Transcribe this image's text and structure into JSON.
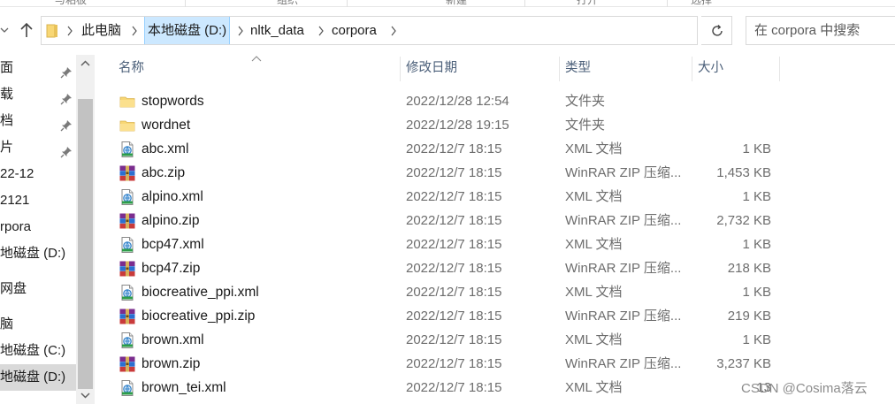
{
  "ribbon": {
    "tabs": [
      "与粘板",
      "组织",
      "新建",
      "打开",
      "选择"
    ]
  },
  "address_bar": {
    "crumbs": [
      "此电脑",
      "本地磁盘 (D:)",
      "nltk_data",
      "corpora"
    ]
  },
  "search": {
    "placeholder": "在 corpora 中搜索"
  },
  "nav_pane": {
    "items": [
      {
        "label": "面",
        "pinned": true
      },
      {
        "label": "载",
        "pinned": true
      },
      {
        "label": "档",
        "pinned": true
      },
      {
        "label": "片",
        "pinned": true
      },
      {
        "label": "22-12",
        "pinned": false
      },
      {
        "label": "2121",
        "pinned": false
      },
      {
        "label": "rpora",
        "pinned": false
      },
      {
        "label": "地磁盘 (D:)",
        "pinned": false
      },
      {
        "label": "网盘",
        "pinned": false
      },
      {
        "label": "脑",
        "pinned": false
      },
      {
        "label": "地磁盘 (C:)",
        "pinned": false
      },
      {
        "label": "地磁盘 (D:)",
        "pinned": false
      }
    ]
  },
  "columns": {
    "name": "名称",
    "date": "修改日期",
    "type": "类型",
    "size": "大小"
  },
  "files": [
    {
      "name": "stopwords",
      "date": "2022/12/28 12:54",
      "type": "文件夹",
      "size": "",
      "icon": "folder-icon"
    },
    {
      "name": "wordnet",
      "date": "2022/12/28 19:15",
      "type": "文件夹",
      "size": "",
      "icon": "folder-icon"
    },
    {
      "name": "abc.xml",
      "date": "2022/12/7 18:15",
      "type": "XML 文档",
      "size": "1 KB",
      "icon": "xml-file-icon"
    },
    {
      "name": "abc.zip",
      "date": "2022/12/7 18:15",
      "type": "WinRAR ZIP 压缩...",
      "size": "1,453 KB",
      "icon": "winrar-archive-icon"
    },
    {
      "name": "alpino.xml",
      "date": "2022/12/7 18:15",
      "type": "XML 文档",
      "size": "1 KB",
      "icon": "xml-file-icon"
    },
    {
      "name": "alpino.zip",
      "date": "2022/12/7 18:15",
      "type": "WinRAR ZIP 压缩...",
      "size": "2,732 KB",
      "icon": "winrar-archive-icon"
    },
    {
      "name": "bcp47.xml",
      "date": "2022/12/7 18:15",
      "type": "XML 文档",
      "size": "1 KB",
      "icon": "xml-file-icon"
    },
    {
      "name": "bcp47.zip",
      "date": "2022/12/7 18:15",
      "type": "WinRAR ZIP 压缩...",
      "size": "218 KB",
      "icon": "winrar-archive-icon"
    },
    {
      "name": "biocreative_ppi.xml",
      "date": "2022/12/7 18:15",
      "type": "XML 文档",
      "size": "1 KB",
      "icon": "xml-file-icon"
    },
    {
      "name": "biocreative_ppi.zip",
      "date": "2022/12/7 18:15",
      "type": "WinRAR ZIP 压缩...",
      "size": "219 KB",
      "icon": "winrar-archive-icon"
    },
    {
      "name": "brown.xml",
      "date": "2022/12/7 18:15",
      "type": "XML 文档",
      "size": "1 KB",
      "icon": "xml-file-icon"
    },
    {
      "name": "brown.zip",
      "date": "2022/12/7 18:15",
      "type": "WinRAR ZIP 压缩...",
      "size": "3,237 KB",
      "icon": "winrar-archive-icon"
    },
    {
      "name": "brown_tei.xml",
      "date": "2022/12/7 18:15",
      "type": "XML 文档",
      "size": "13",
      "icon": "xml-file-icon"
    }
  ],
  "watermark": "CSDN @Cosima落云",
  "colors": {
    "selection": "#cce8ff",
    "header_text": "#4c607a",
    "folder": "#f8d775"
  }
}
